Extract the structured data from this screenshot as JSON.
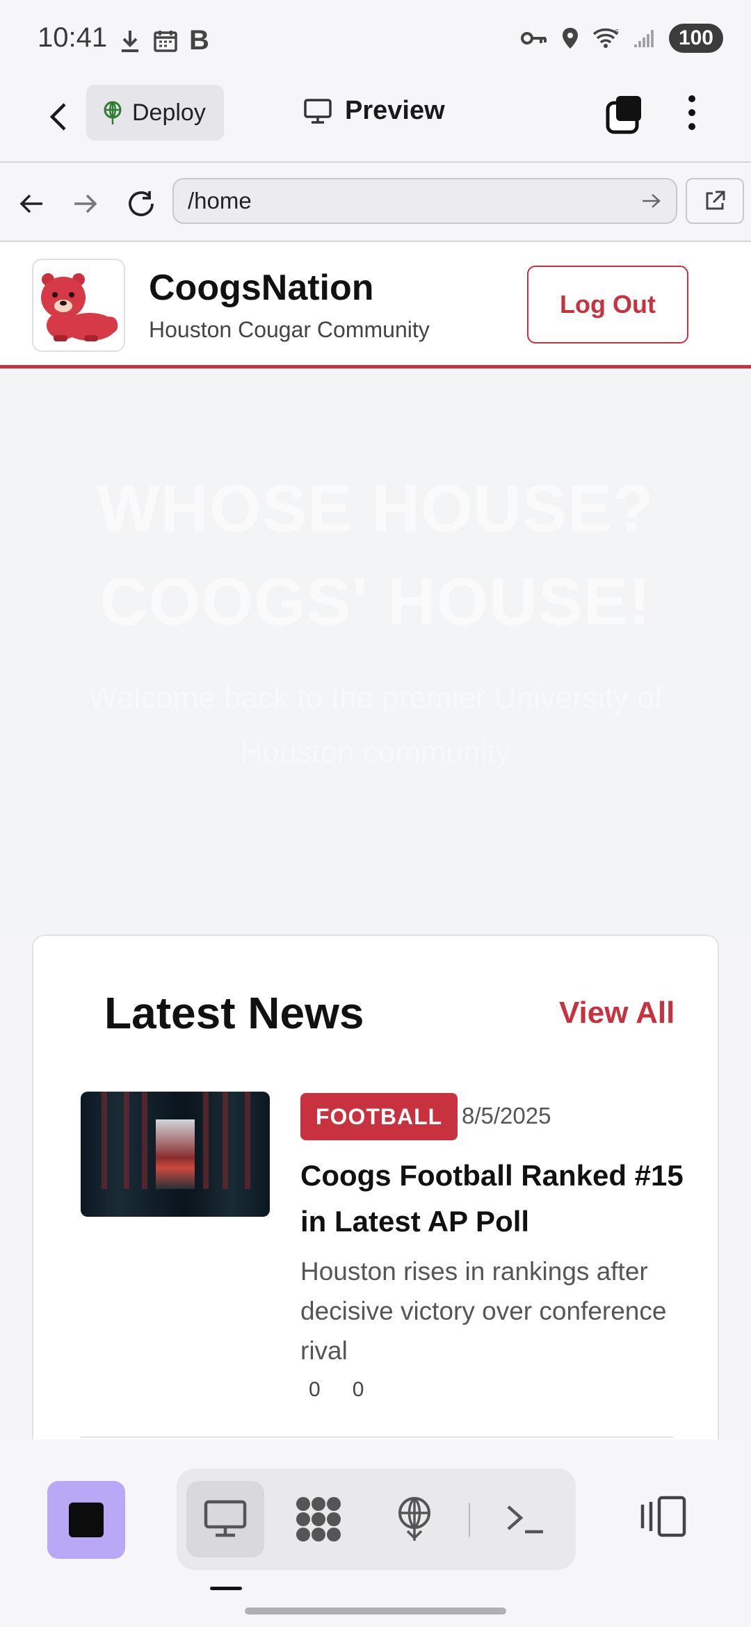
{
  "status_bar": {
    "time": "10:41",
    "left_icons": [
      "download-icon",
      "calendar-icon",
      "b-icon"
    ],
    "b_glyph": "B",
    "right_icons": [
      "vpn-key-icon",
      "location-icon",
      "wifi-icon",
      "signal-icon"
    ],
    "battery": "100"
  },
  "app_bar": {
    "deploy_label": "Deploy",
    "preview_label": "Preview"
  },
  "url_bar": {
    "path": "/home"
  },
  "site": {
    "name": "CoogsNation",
    "tagline": "Houston Cougar Community",
    "logout_label": "Log Out"
  },
  "hero": {
    "title_line1": "WHOSE HOUSE?",
    "title_line2": "COOGS' HOUSE!",
    "subtitle": "Welcome back to the premier University of Houston community"
  },
  "news": {
    "heading": "Latest News",
    "view_all": "View All",
    "items": [
      {
        "category": "FOOTBALL",
        "date": "8/5/2025",
        "title": "Coogs Football Ranked #15 in Latest AP Poll",
        "description": "Houston rises in rankings after decisive victory over conference rival",
        "count_a": "0",
        "count_b": "0"
      }
    ]
  },
  "colors": {
    "accent": "#c8313e",
    "stop_button": "#b9a8f5"
  },
  "toolbar": {
    "tools": [
      "desktop-icon",
      "apps-icon",
      "deploy-icon",
      "terminal-icon"
    ],
    "active": "desktop-icon"
  }
}
